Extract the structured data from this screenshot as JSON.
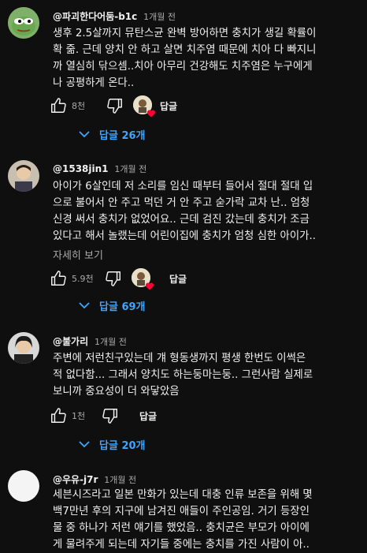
{
  "comments": [
    {
      "author": "@파괴한다어둠-b1c",
      "time": "1개월 전",
      "lines": [
        "생후 2.5살까지 뮤탄스균 완벽 방어하면 충치가 생길 확률이",
        "확 줆. 근데 양치 안 하고 살면 치주염 때문에 치아 다 빠지니",
        "까 열심히 닦으셈..치아 아무리 건강해도 치주염은 누구에게",
        "나 공평하게 온다.."
      ],
      "likes": "8천",
      "reply_label": "답글",
      "replies": "답글 26개"
    },
    {
      "author": "@1538jin1",
      "time": "1개월 전",
      "lines": [
        "아이가 6살인데 저 소리를 임신 때부터 들어서 절대 절대 입",
        "으로 불어서 안 주고 먹던 거 안 주고 숟가락 교차 난.. 엄청",
        "신경 써서 충치가 없었어요.. 근데 검진 갔는데 충치가 조금",
        "있다고 해서 놀랬는데 어린이집에 충치가 엄청 심한 아이가.."
      ],
      "more": "자세히 보기",
      "likes": "5.9천",
      "reply_label": "답글",
      "replies": "답글 69개"
    },
    {
      "author": "@불가리",
      "time": "1개월 전",
      "lines": [
        "주변에 저런친구있는데 걔 형동생까지 평생 한번도 이썩은",
        "적 없다함... 그래서 양치도 하는둥마는둥.. 그런사람 실제로",
        "보니까 중요성이 더 와닿았음"
      ],
      "likes": "1천",
      "reply_label": "답글",
      "replies": "답글 20개"
    },
    {
      "author": "@우유-j7r",
      "time": "1개월 전",
      "lines": [
        "세븐시즈라고 일본 만화가 있는데 대충 인류 보존을 위해 몇",
        "백7만년 후의 지구에 남겨진 애들이 주인공임. 거기 등장인",
        "물 중 하나가 저런 얘기를 했었음.. 충치균은 부모가 아이에",
        "게 물려주게 되는데 자기들 중에는 충치를 가진 사람이 아.."
      ]
    }
  ],
  "colors": {
    "background": "#0f0f0f",
    "text": "#f1f1f1",
    "secondary": "#aaaaaa",
    "link": "#3ea6ff",
    "heart": "#ff0033"
  }
}
